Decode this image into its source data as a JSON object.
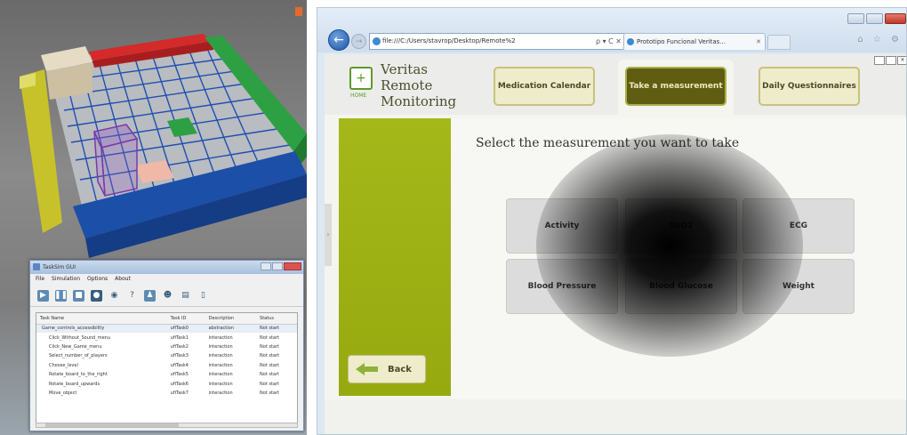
{
  "left_app": {
    "window_title": "TaskSim GUI",
    "menu": [
      "File",
      "Simulation",
      "Options",
      "About"
    ],
    "toolbar_icons": [
      "play-icon",
      "pause-icon",
      "stop-icon",
      "record-icon",
      "eye-icon",
      "hint-icon",
      "person-icon",
      "face-icon",
      "document-icon",
      "trash-icon"
    ],
    "table": {
      "headers": [
        "Task Name",
        "Task ID",
        "Description",
        "Status"
      ],
      "rows": [
        {
          "name": "Game_controls_accessibility",
          "id": "ufiTask0",
          "description": "abstraction",
          "status": "Not start"
        },
        {
          "name": "Click_Without_Sound_menu",
          "id": "ufiTask1",
          "description": "interaction",
          "status": "Not start"
        },
        {
          "name": "Click_New_Game_menu",
          "id": "ufiTask2",
          "description": "interaction",
          "status": "Not start"
        },
        {
          "name": "Select_number_of_players",
          "id": "ufiTask3",
          "description": "interaction",
          "status": "Not start"
        },
        {
          "name": "Choose_level",
          "id": "ufiTask4",
          "description": "interaction",
          "status": "Not start"
        },
        {
          "name": "Rotate_board_to_the_right",
          "id": "ufiTask5",
          "description": "interaction",
          "status": "Not start"
        },
        {
          "name": "Rotate_board_upwards",
          "id": "ufiTask6",
          "description": "interaction",
          "status": "Not start"
        },
        {
          "name": "Move_object",
          "id": "ufiTask7",
          "description": "interaction",
          "status": "Not start"
        }
      ]
    }
  },
  "browser": {
    "address": "file:///C:/Users/stavrop/Desktop/Remote%2",
    "address_controls": "ρ ▾ C ✕",
    "tab_title": "Prototipo Funcional Veritas...",
    "tab_close": "✕",
    "cmd_icons": "⌂ ☆ ⚙"
  },
  "app": {
    "logo_lines": [
      "Veritas",
      "Remote",
      "Monitoring"
    ],
    "logo_home_label": "HOME",
    "nav": {
      "medication": "Medication Calendar",
      "take": "Take a measurement",
      "daily": "Daily Questionnaires"
    },
    "prompt": "Select  the measurement you want to take",
    "measurements": {
      "activity": "Activity",
      "spo2": "SpO2",
      "ecg": "ECG",
      "blood_pressure": "Blood Pressure",
      "blood_glucose": "Blood Glucose",
      "weight": "Weight"
    },
    "back_label": "Back",
    "collapse_glyph": "›"
  },
  "colors": {
    "sidebar_green": "#a4b81a",
    "active_nav": "#5f5d12",
    "nav_button": "#eeeccb",
    "board_grid": "#1f4fb2",
    "board_red": "#d42a2a",
    "board_green": "#2da043",
    "board_yellow": "#c8c22a",
    "board_blue": "#1b4fa8"
  }
}
